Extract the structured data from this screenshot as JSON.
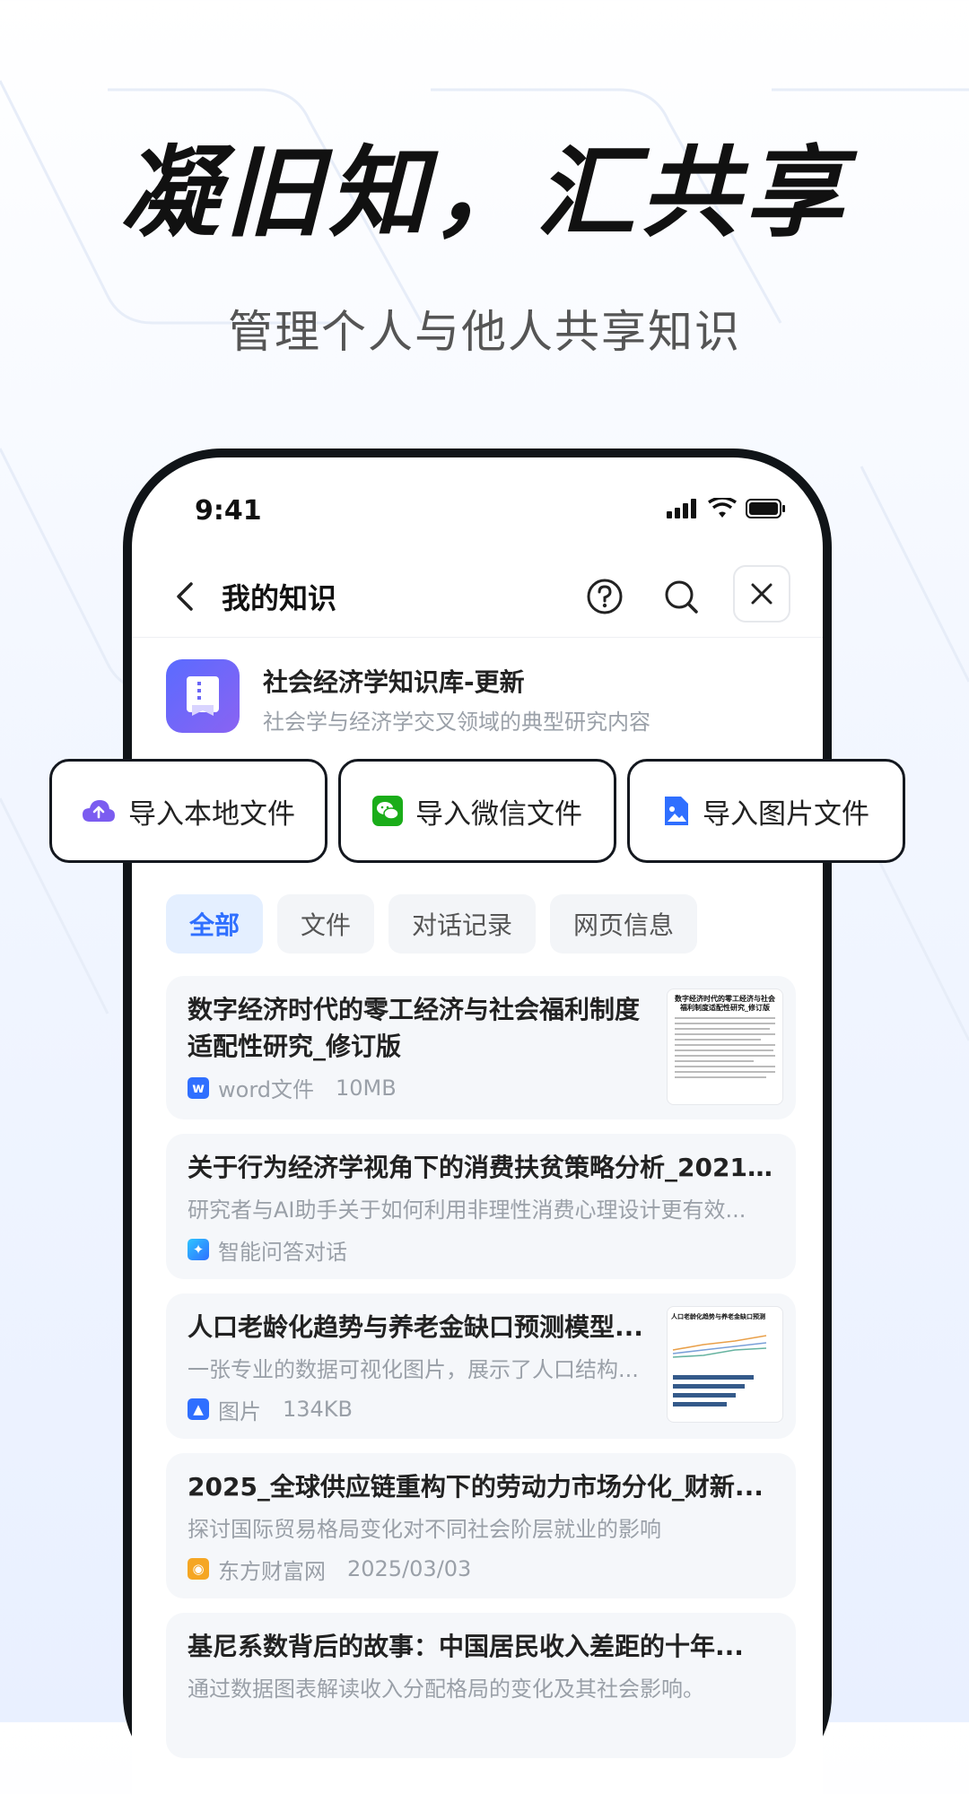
{
  "headline": "凝旧知，汇共享",
  "subhead": "管理个人与他人共享知识",
  "status": {
    "time": "9:41"
  },
  "nav": {
    "title": "我的知识"
  },
  "kb": {
    "title": "社会经济学知识库-更新",
    "desc": "社会学与经济学交叉领域的典型研究内容"
  },
  "imports": [
    {
      "label": "导入本地文件",
      "icon": "cloud-upload-icon"
    },
    {
      "label": "导入微信文件",
      "icon": "wechat-icon"
    },
    {
      "label": "导入图片文件",
      "icon": "image-file-icon"
    }
  ],
  "filters": [
    "全部",
    "文件",
    "对话记录",
    "网页信息"
  ],
  "items": [
    {
      "title": "数字经济时代的零工经济与社会福利制度适配性研究_修订版",
      "type": "word文件",
      "size": "10MB",
      "thumb_title": "数字经济时代的零工经济与社会福利制度适配性研究_修订版"
    },
    {
      "title": "关于行为经济学视角下的消费扶贫策略分析_2021...",
      "desc": "研究者与AI助手关于如何利用非理性消费心理设计更有效...",
      "type": "智能问答对话"
    },
    {
      "title": "人口老龄化趋势与养老金缺口预测模型...",
      "desc": "一张专业的数据可视化图片，展示了人口结构...",
      "type": "图片",
      "size": "134KB",
      "thumb_title": "人口老龄化趋势与养老金缺口预测"
    },
    {
      "title": "2025_全球供应链重构下的劳动力市场分化_财新...",
      "desc": "探讨国际贸易格局变化对不同社会阶层就业的影响",
      "source": "东方财富网",
      "date": "2025/03/03"
    },
    {
      "title": "基尼系数背后的故事：中国居民收入差距的十年...",
      "desc": "通过数据图表解读收入分配格局的变化及其社会影响。"
    }
  ],
  "colors": {
    "accent": "#2f6fff",
    "kb_icon": "#6a66f7",
    "wechat": "#1aad19",
    "source_icon": "#f5a623"
  }
}
